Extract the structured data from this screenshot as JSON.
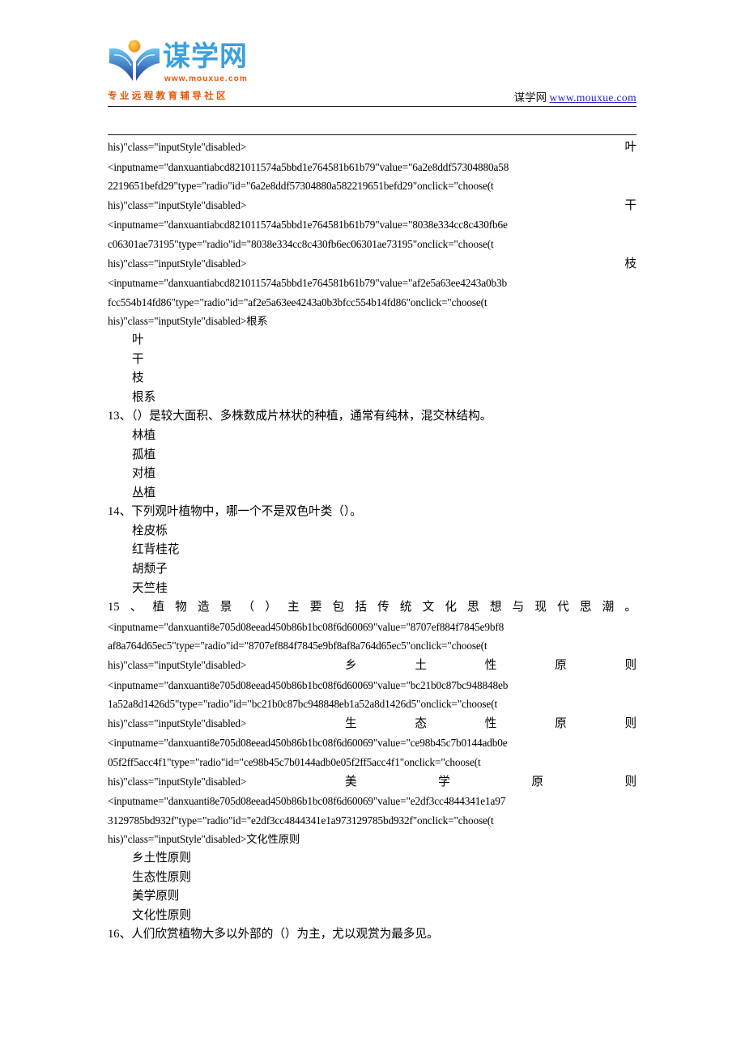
{
  "header": {
    "logo": {
      "wordmark": "谋学网",
      "url": "www.mouxue.com",
      "tagline": "专业远程教育辅导社区"
    },
    "right_site_name": "谋学网",
    "right_site_url": "www.mouxue.com"
  },
  "content": {
    "q12_tail": {
      "code_lines": [
        {
          "code": "his)\"class=\"inputStyle\"disabled>",
          "option": "叶"
        },
        {
          "code": "<inputname=\"danxuantiabcd821011574a5bbd1e764581b61b79\"value=\"6a2e8ddf57304880a58"
        },
        {
          "code": "2219651befd29\"type=\"radio\"id=\"6a2e8ddf57304880a582219651befd29\"onclick=\"choose(t"
        },
        {
          "code": "his)\"class=\"inputStyle\"disabled>",
          "option": "干"
        },
        {
          "code": "<inputname=\"danxuantiabcd821011574a5bbd1e764581b61b79\"value=\"8038e334cc8c430fb6e"
        },
        {
          "code": "c06301ae73195\"type=\"radio\"id=\"8038e334cc8c430fb6ec06301ae73195\"onclick=\"choose(t"
        },
        {
          "code": "his)\"class=\"inputStyle\"disabled>",
          "option": "枝"
        },
        {
          "code": "<inputname=\"danxuantiabcd821011574a5bbd1e764581b61b79\"value=\"af2e5a63ee4243a0b3b"
        },
        {
          "code": "fcc554b14fd86\"type=\"radio\"id=\"af2e5a63ee4243a0b3bfcc554b14fd86\"onclick=\"choose(t"
        },
        {
          "code": "his)\"class=\"inputStyle\"disabled>根系"
        }
      ],
      "options": [
        "叶",
        "干",
        "枝",
        "根系"
      ]
    },
    "q13": {
      "number": "13",
      "text": "13、（）是较大面积、多株数成片林状的种植，通常有纯林，混交林结构。",
      "options": [
        "林植",
        "孤植",
        "对植",
        "丛植"
      ]
    },
    "q14": {
      "number": "14",
      "text": "14、下列观叶植物中，哪一个不是双色叶类（）。",
      "options": [
        "栓皮栎",
        "红背桂花",
        "胡颓子",
        "天竺桂"
      ]
    },
    "q15": {
      "number": "15",
      "stem": "15、植物造景（）主要包括传统文化思想与现代思潮。",
      "code_lines": [
        {
          "code": "<inputname=\"danxuanti8e705d08eead450b86b1bc08f6d60069\"value=\"8707ef884f7845e9bf8"
        },
        {
          "code": "af8a764d65ec5\"type=\"radio\"id=\"8707ef884f7845e9bf8af8a764d65ec5\"onclick=\"choose(t"
        },
        {
          "code": "his)\"class=\"inputStyle\"disabled>",
          "option_spread": "乡土性原则"
        },
        {
          "code": "<inputname=\"danxuanti8e705d08eead450b86b1bc08f6d60069\"value=\"bc21b0c87bc948848eb"
        },
        {
          "code": "1a52a8d1426d5\"type=\"radio\"id=\"bc21b0c87bc948848eb1a52a8d1426d5\"onclick=\"choose(t"
        },
        {
          "code": "his)\"class=\"inputStyle\"disabled>",
          "option_spread": "生态性原则"
        },
        {
          "code": "<inputname=\"danxuanti8e705d08eead450b86b1bc08f6d60069\"value=\"ce98b45c7b0144adb0e"
        },
        {
          "code": "05f2ff5acc4f1\"type=\"radio\"id=\"ce98b45c7b0144adb0e05f2ff5acc4f1\"onclick=\"choose(t"
        },
        {
          "code": "his)\"class=\"inputStyle\"disabled>",
          "option_spread": "美学原则"
        },
        {
          "code": "<inputname=\"danxuanti8e705d08eead450b86b1bc08f6d60069\"value=\"e2df3cc4844341e1a97"
        },
        {
          "code": "3129785bd932f\"type=\"radio\"id=\"e2df3cc4844341e1a973129785bd932f\"onclick=\"choose(t"
        },
        {
          "code": "his)\"class=\"inputStyle\"disabled>文化性原则"
        }
      ],
      "options": [
        "乡土性原则",
        "生态性原则",
        "美学原则",
        "文化性原则"
      ]
    },
    "q16": {
      "number": "16",
      "text": "16、人们欣赏植物大多以外部的（）为主，尤以观赏为最多见。"
    }
  }
}
